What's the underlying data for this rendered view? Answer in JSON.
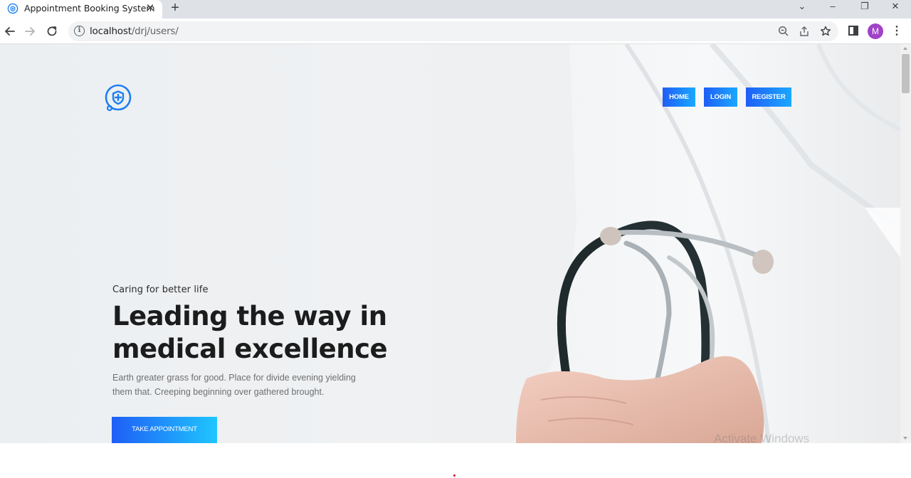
{
  "browser": {
    "tab_title": "Appointment Booking System",
    "tab_close": "✕",
    "new_tab": "+",
    "url_host": "localhost",
    "url_path": "/drj/users/",
    "profile_initial": "M",
    "icons": [
      "back-arrow-icon",
      "forward-arrow-icon",
      "reload-icon",
      "info-icon",
      "zoom-icon",
      "share-icon",
      "star-icon",
      "side-panel-icon",
      "menu-icon"
    ],
    "window_controls": [
      "⌄",
      "–",
      "❐",
      "✕"
    ]
  },
  "header": {
    "logo_icon": "stethoscope-shield-icon",
    "nav": [
      "HOME",
      "LOGIN",
      "REGISTER"
    ]
  },
  "hero": {
    "tagline": "Caring for better life",
    "headline_line1": "Leading the way in",
    "headline_line2": "medical excellence",
    "blurb": "Earth greater grass for good. Place for divide evening yielding them that. Creeping beginning over gathered brought.",
    "cta_label": "TAKE APPOINTMENT"
  },
  "overlay": {
    "watermark": "Activate Windows"
  },
  "colors": {
    "accent_start": "#1f5ef6",
    "accent_end": "#1ac6ff",
    "headline": "#1c1c1c",
    "logo": "#1e7ff2"
  }
}
